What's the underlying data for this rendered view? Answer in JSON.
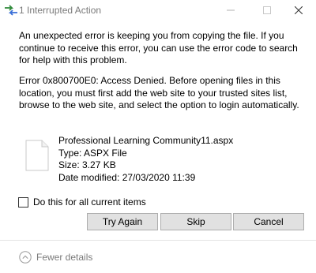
{
  "window": {
    "title": "1 Interrupted Action",
    "icons": {
      "app": "copy-arrows-icon",
      "minimize": "minimize-icon",
      "maximize": "maximize-icon",
      "close": "close-icon"
    }
  },
  "message": {
    "primary": "An unexpected error is keeping you from copying the file. If you continue to receive this error, you can use the error code to search for help with this problem.",
    "error": "Error 0x800700E0: Access Denied. Before opening files in this location, you must first add the web site to your trusted sites list, browse to the web site, and select the option to login automatically."
  },
  "file": {
    "icon": "document-icon",
    "name": "Professional Learning Community11.aspx",
    "type": "Type: ASPX File",
    "size": "Size: 3.27 KB",
    "modified": "Date modified: 27/03/2020 11:39"
  },
  "options": {
    "apply_all_label": "Do this for all current items",
    "apply_all_checked": false
  },
  "buttons": {
    "try_again": "Try Again",
    "skip": "Skip",
    "cancel": "Cancel"
  },
  "footer": {
    "details_label": "Fewer details",
    "icon": "chevron-up-circle-icon"
  },
  "colors": {
    "title_text": "#7a7a7a",
    "button_bg": "#e1e1e1",
    "button_border": "#adadad"
  }
}
